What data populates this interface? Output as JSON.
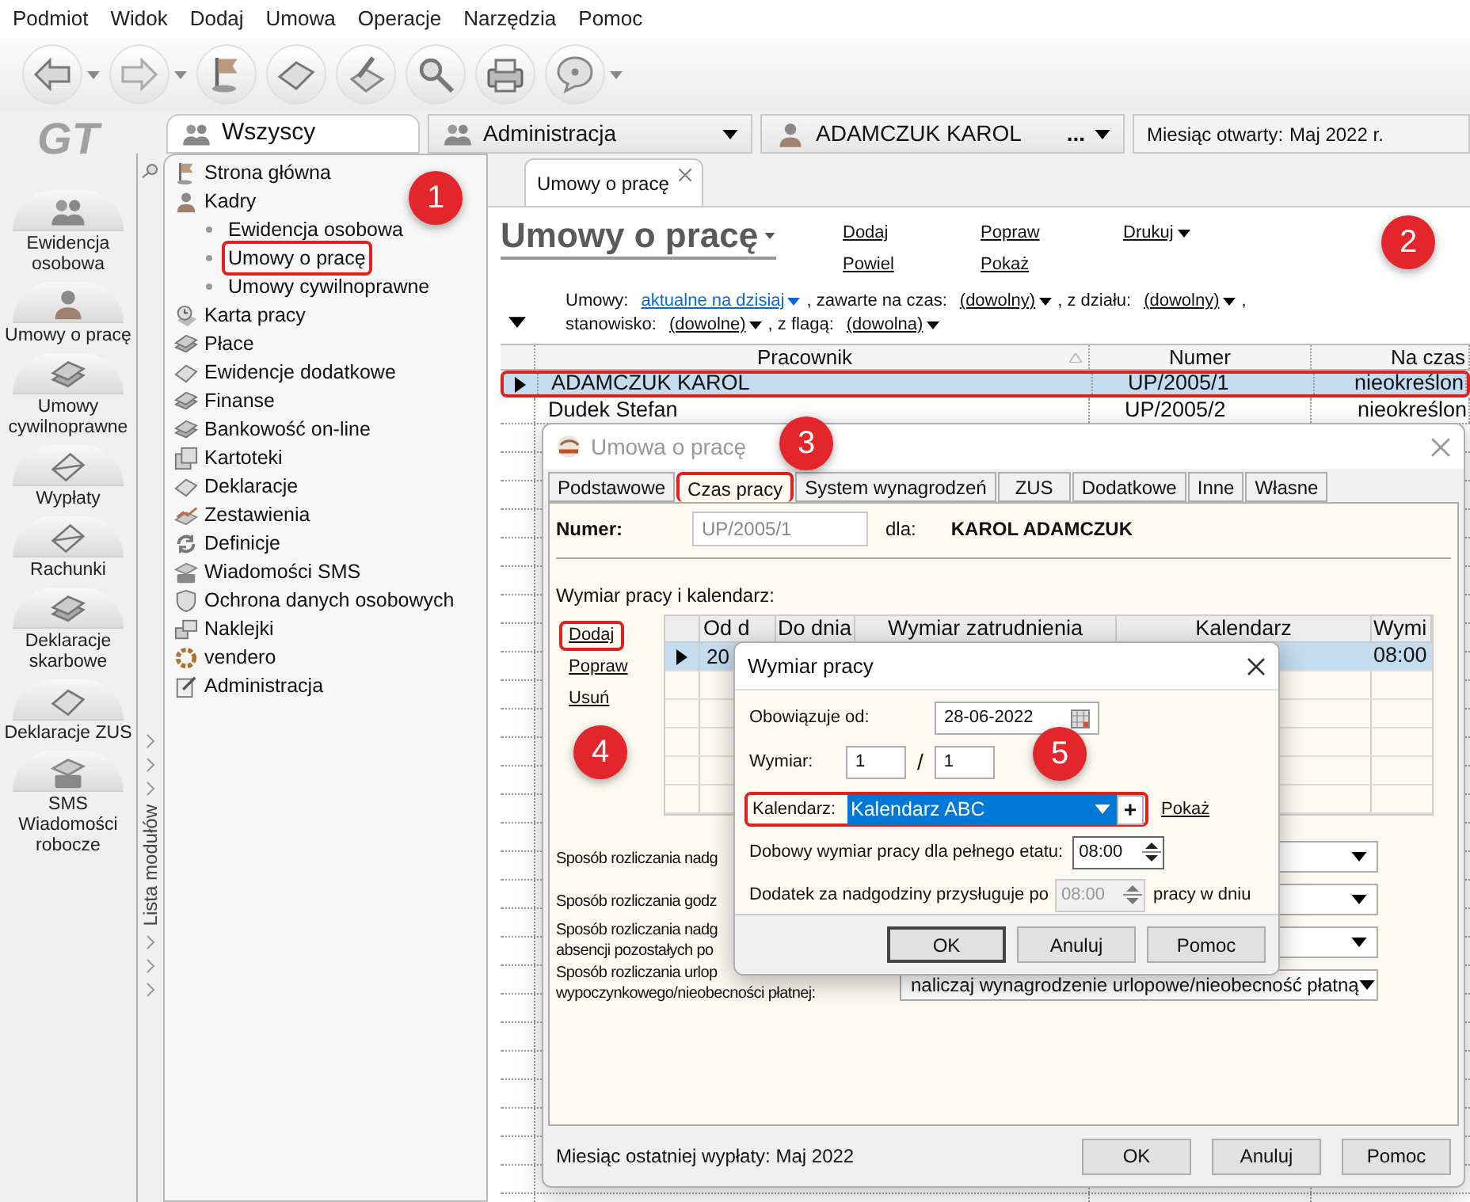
{
  "menu_bar": [
    "Podmiot",
    "Widok",
    "Dodaj",
    "Umowa",
    "Operacje",
    "Narzędzia",
    "Pomoc"
  ],
  "toolbar": [
    {
      "menu": true
    },
    {
      "menu": true
    },
    {
      "menu": false
    },
    {
      "menu": false
    },
    {
      "menu": false
    },
    {
      "menu": false
    },
    {
      "menu": false
    },
    {
      "menu": true
    }
  ],
  "logo": "GT",
  "modules": [
    "Ewidencja osobowa",
    "Umowy o pracę",
    "Umowy cywilnoprawne",
    "Wypłaty",
    "Rachunki",
    "Deklaracje skarbowe",
    "Deklaracje ZUS",
    "SMS Wiadomości robocze"
  ],
  "modules_strip": {
    "title": "Lista modułów"
  },
  "context_tabs": [
    {
      "label": "Wszyscy",
      "selected": true
    },
    {
      "label": "Administracja",
      "selected": false
    },
    {
      "label": "ADAMCZUK KAROL",
      "selected": false,
      "more": "..."
    }
  ],
  "open_month": {
    "label": "Miesiąc otwarty:",
    "value": "Maj 2022 r."
  },
  "tree": [
    {
      "label": "Strona główna"
    },
    {
      "label": "Kadry",
      "children": [
        {
          "label": "Ewidencja osobowa",
          "highlighted": false
        },
        {
          "label": "Umowy o pracę",
          "highlighted": true
        },
        {
          "label": "Umowy cywilnoprawne",
          "highlighted": false
        }
      ]
    },
    {
      "label": "Karta pracy"
    },
    {
      "label": "Płace"
    },
    {
      "label": "Ewidencje dodatkowe"
    },
    {
      "label": "Finanse"
    },
    {
      "label": "Bankowość on-line"
    },
    {
      "label": "Kartoteki"
    },
    {
      "label": "Deklaracje"
    },
    {
      "label": "Zestawienia"
    },
    {
      "label": "Definicje"
    },
    {
      "label": "Wiadomości SMS"
    },
    {
      "label": "Ochrona danych osobowych"
    },
    {
      "label": "Naklejki"
    },
    {
      "label": "vendero"
    },
    {
      "label": "Administracja"
    }
  ],
  "document_tab": {
    "label": "Umowy o pracę"
  },
  "page": {
    "title": "Umowy o pracę",
    "actions": [
      {
        "label": "Dodaj",
        "menu": false
      },
      {
        "label": "Popraw",
        "menu": false
      },
      {
        "label": "Drukuj",
        "menu": true
      },
      {
        "label": "Powiel",
        "menu": false
      },
      {
        "label": "Pokaż",
        "menu": false
      }
    ]
  },
  "filter_lines": [
    {
      "items": [
        {
          "label": "Umowy:",
          "value": "aktualne na dzisiaj",
          "kind": "link"
        },
        {
          "label": ", zawarte na czas:",
          "value": "(dowolny)",
          "kind": "plain"
        },
        {
          "label": ", z działu:",
          "value": "(dowolny)",
          "kind": "plain"
        }
      ],
      "tail": ","
    },
    {
      "items": [
        {
          "label": "stanowisko:",
          "value": "(dowolne)",
          "kind": "plain"
        },
        {
          "label": ", z flagą:",
          "value": "(dowolna)",
          "kind": "plain"
        }
      ]
    }
  ],
  "table": {
    "columns": [
      "Pracownik",
      "Numer",
      "Na czas"
    ],
    "rows": [
      {
        "cells": [
          "ADAMCZUK KAROL",
          "UP/2005/1",
          "nieokreślon"
        ],
        "selected": true,
        "highlighted": true
      },
      {
        "cells": [
          "Dudek Stefan",
          "UP/2005/2",
          "nieokreślon"
        ],
        "selected": false,
        "highlighted": false
      }
    ]
  },
  "contract_dialog": {
    "title": "Umowa o pracę",
    "tabs": [
      {
        "label": "Podstawowe",
        "selected": false,
        "highlighted": false
      },
      {
        "label": "Czas pracy",
        "selected": true,
        "highlighted": true
      },
      {
        "label": "System wynagrodzeń",
        "selected": false,
        "highlighted": false
      },
      {
        "label": "ZUS",
        "selected": false,
        "highlighted": false
      },
      {
        "label": "Dodatkowe",
        "selected": false,
        "highlighted": false
      },
      {
        "label": "Inne",
        "selected": false,
        "highlighted": false
      },
      {
        "label": "Własne",
        "selected": false,
        "highlighted": false
      }
    ],
    "number_label": "Numer:",
    "number": "UP/2005/1",
    "for_label": "dla:",
    "employee": "KAROL ADAMCZUK",
    "section_title": "Wymiar pracy i kalendarz:",
    "actions": [
      {
        "label": "Dodaj",
        "highlighted": true
      },
      {
        "label": "Popraw",
        "highlighted": false
      },
      {
        "label": "Usuń",
        "highlighted": false
      }
    ],
    "grid": {
      "columns": [
        "Od d",
        "Do dnia",
        "Wymiar zatrudnienia",
        "Kalendarz",
        "Wymi"
      ],
      "rows": [
        {
          "column_1": "20",
          "column_5": "08:00",
          "selected": true
        }
      ]
    },
    "settings": [
      {
        "lines": [
          "Sposób rozliczania nadg"
        ]
      },
      {
        "lines": [
          "Sposób rozliczania godz"
        ]
      },
      {
        "lines": [
          "Sposób rozliczania nadg",
          "absencji pozostałych po"
        ]
      },
      {
        "lines": [
          "Sposób rozliczania urlop",
          "wypoczynkowego/nieobecności płatnej:"
        ],
        "value": "naliczaj wynagrodzenie urlopowe/nieobecność płatną"
      }
    ],
    "footer_note": "Miesiąc ostatniej wypłaty: Maj 2022",
    "buttons": [
      {
        "label": "OK",
        "default": false
      },
      {
        "label": "Anuluj",
        "default": false
      },
      {
        "label": "Pomoc",
        "default": false
      }
    ]
  },
  "calendar_dialog": {
    "title": "Wymiar pracy",
    "effective_label": "Obowiązuje od:",
    "effective_date": "28-06-2022",
    "size_label": "Wymiar:",
    "size_numerator": "1",
    "separator": "/",
    "size_denominator": "1",
    "calendar_label": "Kalendarz:",
    "calendar_value": "Kalendarz ABC",
    "calendar_highlighted": true,
    "add_symbol": "+",
    "show_link": "Pokaż",
    "daily_label": "Dobowy wymiar pracy dla pełnego etatu:",
    "daily_value": "08:00",
    "overtime_label": "Dodatek za nadgodziny przysługuje po",
    "overtime_value": "08:00",
    "overtime_disabled": true,
    "overtime_suffix": "pracy w dniu",
    "buttons": [
      {
        "label": "OK",
        "default": true
      },
      {
        "label": "Anuluj",
        "default": false
      },
      {
        "label": "Pomoc",
        "default": false
      }
    ]
  },
  "markers": [
    {
      "label": "1"
    },
    {
      "label": "2"
    },
    {
      "label": "3"
    },
    {
      "label": "4"
    },
    {
      "label": "5"
    }
  ]
}
